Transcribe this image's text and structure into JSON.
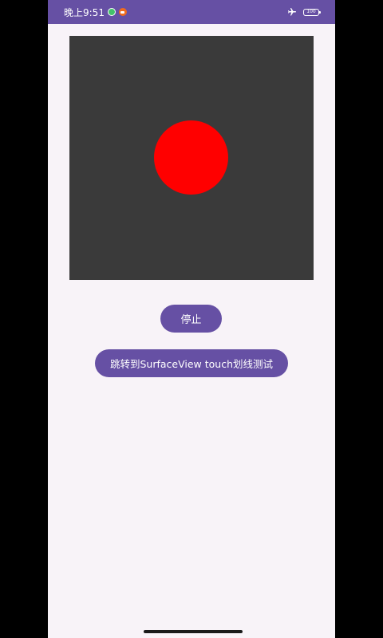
{
  "status_bar": {
    "time": "晚上9:51",
    "battery": "100",
    "color": "#6650a4"
  },
  "surface": {
    "background": "#3a3a3a",
    "ball_color": "#ff0000"
  },
  "buttons": {
    "stop_label": "停止",
    "jump_label": "跳转到SurfaceView touch划线测试",
    "color": "#6650a4"
  }
}
